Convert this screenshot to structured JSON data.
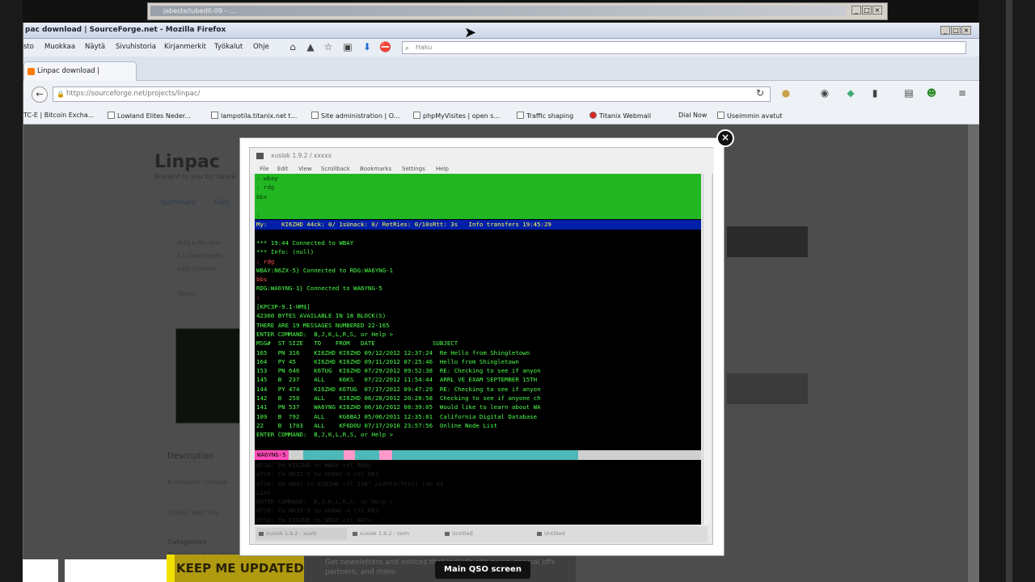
{
  "back_window": {
    "title": "jabeste/lubedit-09 – ..."
  },
  "firefox": {
    "title": "pac download | SourceForge.net - Mozilla Firefox",
    "menu": [
      "sto",
      "Muokkaa",
      "Näytä",
      "Sivuhistoria",
      "Kirjanmerkit",
      "Työkalut",
      "Ohje"
    ],
    "search_placeholder": "Haku",
    "tab_label": "Linpac download | SourceFor...",
    "url": "https://sourceforge.net/projects/linpac/",
    "bookmarks": [
      "TC-E | Bitcoin Excha...",
      "Lowland Elites Neder...",
      "lampotila.titanix.net t...",
      "Site administration | O...",
      "phpMyVisites | open s...",
      "Traffic shaping",
      "Titanix Webmail",
      "Dial Now",
      "Useimmin avatut"
    ]
  },
  "page": {
    "title": "Linpac",
    "subtitle": "Brought to you by: dasca",
    "nav": [
      "Summary",
      "Files"
    ],
    "stats": [
      "Add a Review",
      "13 Downloads",
      "Last Update"
    ],
    "tweet": "Tweet",
    "description_heading": "Description",
    "description_text": "A modular console",
    "linpac_text": "Linpac Web Site",
    "categories_heading": "Categories",
    "categories_text": "Terminals, Ham Radio"
  },
  "banner": {
    "keep_updated": "KEEP ME UPDATED",
    "grey_text_1": "Get newsletters and notices that include site news, special offers and exclusive discounts about IT products & services",
    "grey_text_2": "partners, and more."
  },
  "caption": "Main QSO screen",
  "terminal": {
    "title": "xuslok 1.9.2 / xxxxx",
    "menu": [
      "File",
      "Edit",
      "View",
      "Scrollback",
      "Bookmarks",
      "Settings",
      "Help"
    ],
    "green_pane": [
      ": wbay",
      ": rdg",
      "bbs",
      "",
      ":"
    ],
    "status_bar": "My:    KI6ZHD 44ck: 0/ 1sUnack: 0/ RetRies: 0/10sRtt: 3s   Info transfers 19:45:29",
    "log": [
      {
        "c": "g",
        "t": "*** 19:44 Connected to WBAY"
      },
      {
        "c": "g",
        "t": "*** Info: (null)"
      },
      {
        "c": "r",
        "t": ": rdg"
      },
      {
        "c": "g",
        "t": "WBAY:N6ZX-5} Connected to RDG:WA6YNG-1"
      },
      {
        "c": "r",
        "t": "bbs"
      },
      {
        "c": "g",
        "t": "RDG:WA6YNG-1} Connected to WA6YNG-5"
      },
      {
        "c": "r",
        "t": ":"
      },
      {
        "c": "g",
        "t": "[KPC3P-9.1-HM$]"
      },
      {
        "c": "g",
        "t": "42360 BYTES AVAILABLE IN 18 BLOCK(S)"
      },
      {
        "c": "g",
        "t": "THERE ARE 19 MESSAGES NUMBERED 22-165"
      },
      {
        "c": "g",
        "t": "ENTER COMMAND:  B,J,K,L,R,S, or Help >"
      },
      {
        "c": "g",
        "t": "MSG#  ST SIZE   TO    FROM   DATE                SUBJECT"
      },
      {
        "c": "g",
        "t": "165   PN 316    KI6ZHD KI6ZHD 09/12/2012 12:37:24  Re Hello from Shingletown"
      },
      {
        "c": "g",
        "t": "164   PY 45     KI6ZHD KI6ZHD 09/11/2012 07:25:46  Hello from Shingletown"
      },
      {
        "c": "g",
        "t": "153   PN 646    K6TUG  KI6ZHD 07/29/2012 09:52:38  RE: Checking to see if anyon"
      },
      {
        "c": "g",
        "t": "145   B  237    ALL    K6KS   07/22/2012 11:54:44  ARRL VE EXAM SEPTEMBER 15TH"
      },
      {
        "c": "g",
        "t": "144   PY 474    KI6ZHD K6TUG  07/17/2012 09:47:29  RE: Checking to see if anyon"
      },
      {
        "c": "g",
        "t": "142   B  250    ALL    KI6ZHD 06/28/2012 20:28:58  Checking to see if anyone ch"
      },
      {
        "c": "g",
        "t": "141   PN 537    WA6YNG KI6ZHD 06/16/2012 08:39:05  Would like to learn about WA"
      },
      {
        "c": "g",
        "t": "109   B  792    ALL    KG6BAJ 05/06/2011 12:35:01  California Digital Database"
      },
      {
        "c": "g",
        "t": "22    B  1703   ALL    KF6DOU 07/17/2010 23:57:56  Online Node List"
      },
      {
        "c": "g",
        "t": "ENTER COMMAND:  B,J,K,L,R,S, or Help >"
      }
    ],
    "monitor_label": "WA6YNG-5",
    "monitor": [
      {
        "c": "r",
        "t": "d710: fm KI6ZHD to WBAY ctl RR6v"
      },
      {
        "c": "g",
        "t": "d710: fm N6ZX-5 to KK6AC-4 ctl RR1-"
      },
      {
        "c": "g",
        "t": "d710: fm WBAY to KI6ZHD ctl I30^ pid=F0(Text) len 44"
      },
      {
        "c": "g",
        "t": "List"
      },
      {
        "c": "g",
        "t": "ENTER COMMAND:  B,J,K,L,R,S, or Help >"
      },
      {
        "c": "g",
        "t": "d710: fm N6ZX-5 to KK6AC-4 ctl RR2-"
      },
      {
        "c": "r",
        "t": "d710: fm KI6ZHD to WBAY ctl RR7v"
      }
    ],
    "tabs": [
      "xuslok 1.9.2 : xuslk",
      "xuslok 1.9.2 : term",
      "Untitled",
      "Untitled"
    ]
  }
}
